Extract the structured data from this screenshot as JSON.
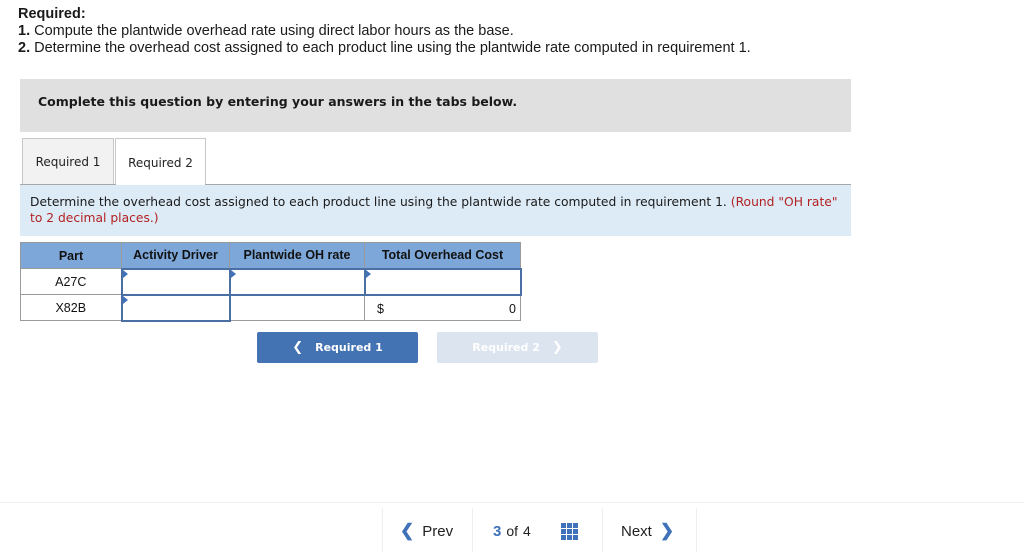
{
  "required": {
    "title": "Required:",
    "items": [
      {
        "num": "1.",
        "text": " Compute the plantwide overhead rate using direct labor hours as the base."
      },
      {
        "num": "2.",
        "text": " Determine the overhead cost assigned to each product line using the plantwide rate computed in requirement 1."
      }
    ]
  },
  "banner": "Complete this question by entering your answers in the tabs below.",
  "tabs": [
    {
      "label": "Required 1",
      "active": false
    },
    {
      "label": "Required 2",
      "active": true
    }
  ],
  "instruction": {
    "text": "Determine the overhead cost assigned to each product line using the plantwide rate computed in requirement 1. ",
    "note": "(Round \"OH rate\" to 2 decimal places.)"
  },
  "table": {
    "headers": [
      "Part",
      "Activity Driver",
      "Plantwide OH rate",
      "Total Overhead Cost"
    ],
    "rows": [
      {
        "part": "A27C",
        "activity_driver": "",
        "oh_rate": "",
        "total_cost": ""
      },
      {
        "part": "X82B",
        "activity_driver": "",
        "oh_rate": "",
        "total_currency": "$",
        "total_cost": "0"
      }
    ]
  },
  "nav_buttons": {
    "prev_label": "Required 1",
    "next_label": "Required 2"
  },
  "pager": {
    "prev": "Prev",
    "current": "3",
    "of": "of",
    "total": "4",
    "next": "Next"
  }
}
